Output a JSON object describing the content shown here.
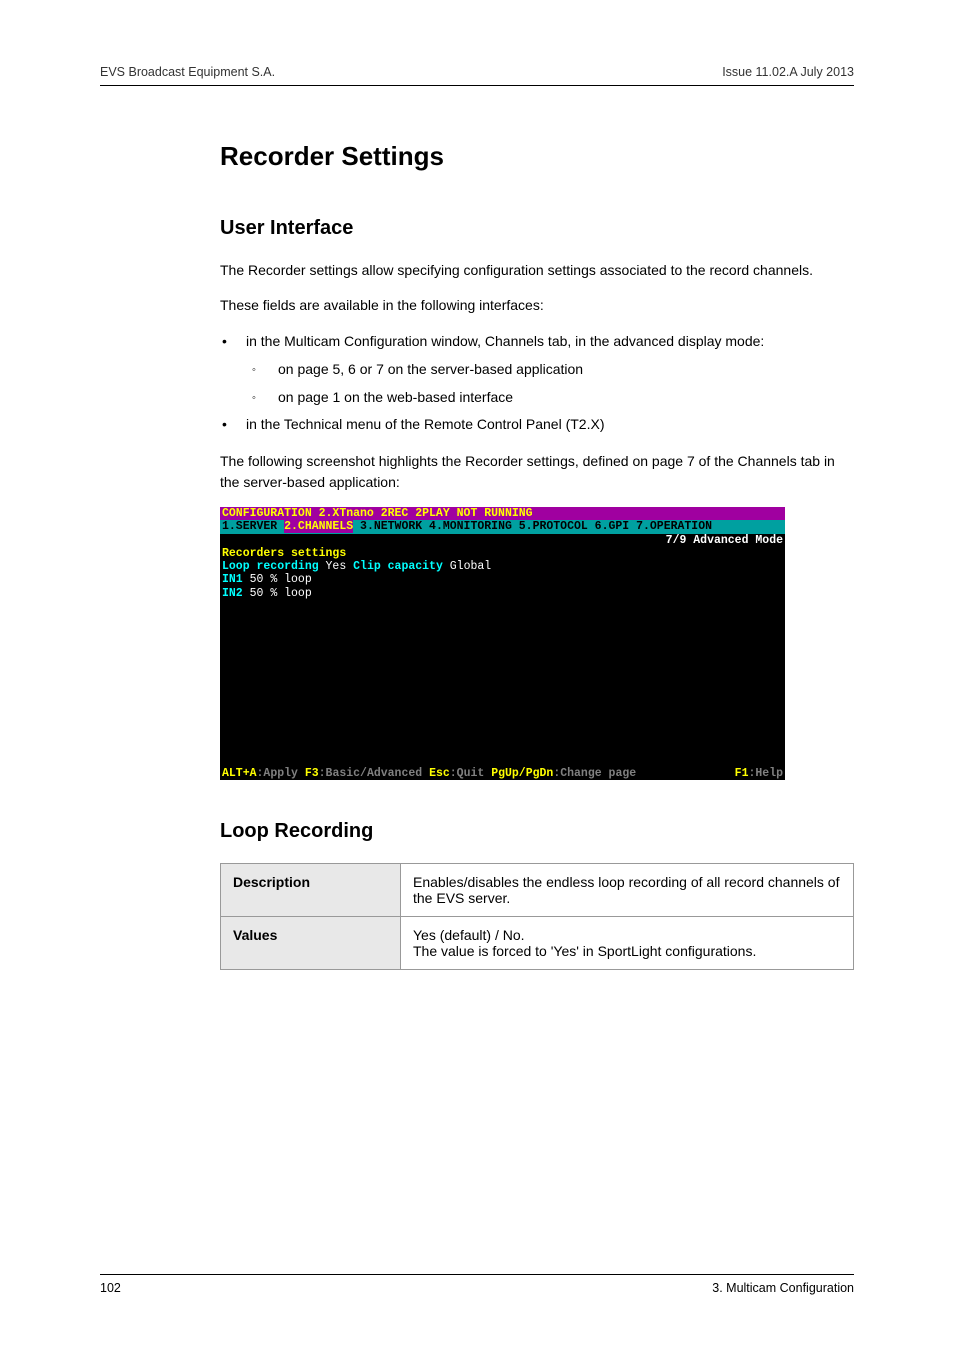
{
  "header": {
    "left": "EVS Broadcast Equipment S.A.",
    "right": "Issue 11.02.A  July 2013"
  },
  "main": {
    "title": "Recorder Settings",
    "section1": {
      "heading": "User Interface",
      "p1": "The Recorder settings allow specifying configuration settings associated to the record channels.",
      "p2": "These fields are available in the following interfaces:",
      "li1": "in the Multicam Configuration window, Channels tab, in the advanced display mode:",
      "li1a": "on page 5, 6 or 7 on the server-based application",
      "li1b": "on page 1 on the web-based interface",
      "li2": "in the Technical menu of the Remote Control Panel (T2.X)",
      "p3": "The following screenshot highlights the Recorder settings, defined on page 7 of the Channels tab in the server-based application:"
    },
    "terminal": {
      "line1": "              CONFIGURATION  2.XTnano 2REC 2PLAY NOT RUNNING",
      "tabs_pre": "1.SERVER ",
      "tabs_active": "2.CHANNELS",
      "tabs_post": " 3.NETWORK 4.MONITORING 5.PROTOCOL 6.GPI 7.OPERATION",
      "mode": "7/9 Advanced Mode",
      "body_hdr": "Recorders settings",
      "body_row1_lbl": "Loop recording",
      "body_row1_val": " Yes       ",
      "body_row1_lbl2": "Clip capacity",
      "body_row1_val2": "   Global",
      "body_row2_lbl": "IN1",
      "body_row2_val": " 50 % loop",
      "body_row3_lbl": "IN2",
      "body_row3_val": " 50 % loop",
      "foot_k1": "ALT+A",
      "foot_a1": ":Apply ",
      "foot_k2": "F3",
      "foot_a2": ":Basic/Advanced ",
      "foot_k3": "Esc",
      "foot_a3": ":Quit ",
      "foot_k4": "PgUp/PgDn",
      "foot_a4": ":Change page",
      "foot_k5": "F1",
      "foot_a5": ":Help"
    },
    "section2": {
      "heading": "Loop Recording",
      "row1_label": "Description",
      "row1_value": "Enables/disables the endless loop recording of all record channels of the EVS server.",
      "row2_label": "Values",
      "row2_value": "Yes (default) / No.\nThe value is forced to 'Yes' in SportLight configurations."
    }
  },
  "footer": {
    "left": "102",
    "right": "3. Multicam Configuration"
  }
}
